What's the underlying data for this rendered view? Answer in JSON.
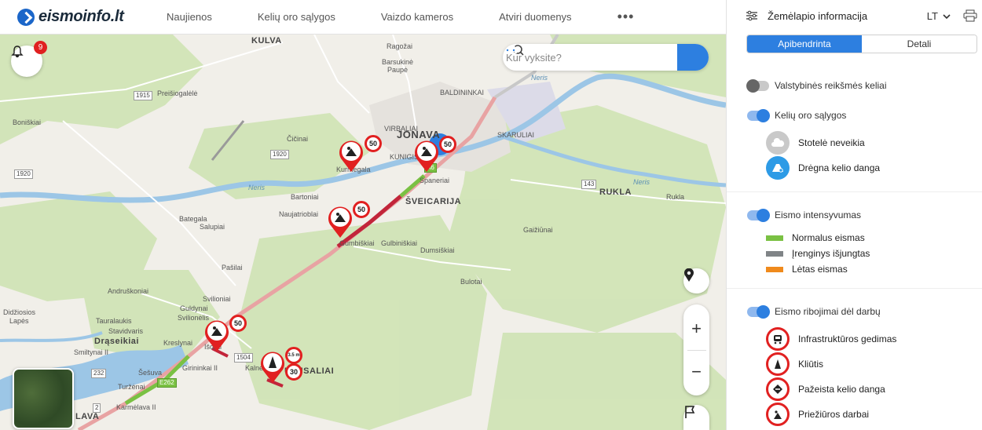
{
  "header": {
    "logo_text": "eismoinfo.lt",
    "nav": [
      "Naujienos",
      "Kelių oro sąlygos",
      "Vaizdo kameros",
      "Atviri duomenys"
    ],
    "more": "•••"
  },
  "map": {
    "notifications_count": "9",
    "search_placeholder": "Kur vyksite?",
    "zoom_in": "+",
    "zoom_out": "−",
    "labels": {
      "kulva": "KULVA",
      "ragozai": "Ragožai",
      "barsukine": "Barsukinė",
      "paupe": "Paupė",
      "baldininkai": "BALDININKAI",
      "preisiogalele": "Preišiogalėlė",
      "bonisk": "Boniškiai",
      "virbaliai": "VIRBALIAI",
      "jonava": "JONAVA",
      "cicinai": "Čičinai",
      "skaruliai": "SKARULIAI",
      "kunigiskiai": "KUNIGIŠKIAI",
      "kurmegala": "Kurmegala",
      "spaneriai": "Spaneriai",
      "nerisE": "Neris",
      "rukla": "RUKLA",
      "ruklaSmall": "Rukla",
      "bartoniai": "Bartoniai",
      "sveicarija": "ŠVEICARIJA",
      "nerisW": "Neris",
      "naujatrioblai": "Naujatrioblai",
      "bategala": "Bategala",
      "salupiai": "Salupiai",
      "gaiziunai": "Gaižiūnai",
      "gumbiskiai": "Gumbiškiai",
      "gulbiniskiai": "Gulbiniškiai",
      "dumsiskiai": "Dumsiškiai",
      "pasilai": "Pašilai",
      "bulotai": "Bulotai",
      "andruskoniai": "Andruškoniai",
      "svilioniai": "Svilioniai",
      "guldynai": "Guldynai",
      "svilionelis": "Svilionėlis",
      "didziosios": "Didžiosios",
      "lapes": "Lapės",
      "tauralaukis": "Tauralaukis",
      "stavidvaris": "Stavidvaris",
      "draseikiai": "Drąseikiai",
      "smiltynai": "Smiltynai II",
      "kreslynai": "Kreslynai",
      "isorai": "Išorai",
      "girininkai": "Girininkai II",
      "kalnenai": "Kalnėnai",
      "seseva": "Šešuva",
      "turzenai": "Turžėnai",
      "uzusaliai": "UŽUSALIAI",
      "karmelava": "Karmėlava II",
      "lava": "LAVA"
    },
    "shields": {
      "s1915": "1915",
      "s1920": "1920",
      "s1920b": "1920",
      "s143": "143",
      "a6": "A6",
      "s1504": "1504",
      "s232": "232",
      "s2": "2",
      "s262": "E262",
      "s267": "E262"
    },
    "speed_signs": [
      "50",
      "50",
      "50",
      "50",
      "30"
    ],
    "height_sign": "3.5 m"
  },
  "panel": {
    "title": "Žemėlapio informacija",
    "language": "LT",
    "tabs": [
      {
        "label": "Apibendrinta",
        "active": true
      },
      {
        "label": "Detali",
        "active": false
      }
    ],
    "state_roads": {
      "label": "Valstybinės reikšmės keliai",
      "on": false
    },
    "weather": {
      "label": "Kelių oro sąlygos",
      "on": true,
      "items": [
        "Stotelė neveikia",
        "Drėgna kelio danga"
      ]
    },
    "traffic": {
      "label": "Eismo intensyvumas",
      "on": true,
      "items": [
        {
          "label": "Normalus eismas",
          "color": "#7ac143"
        },
        {
          "label": "Įrenginys išjungtas",
          "color": "#808487"
        },
        {
          "label": "Lėtas eismas",
          "color": "#f08a1c"
        }
      ]
    },
    "works": {
      "label": "Eismo ribojimai dėl darbų",
      "on": true,
      "items": [
        "Infrastruktūros gedimas",
        "Kliūtis",
        "Pažeista kelio danga",
        "Priežiūros darbai"
      ]
    }
  },
  "colors": {
    "accent": "#2d7fe0",
    "danger": "#e12020"
  }
}
